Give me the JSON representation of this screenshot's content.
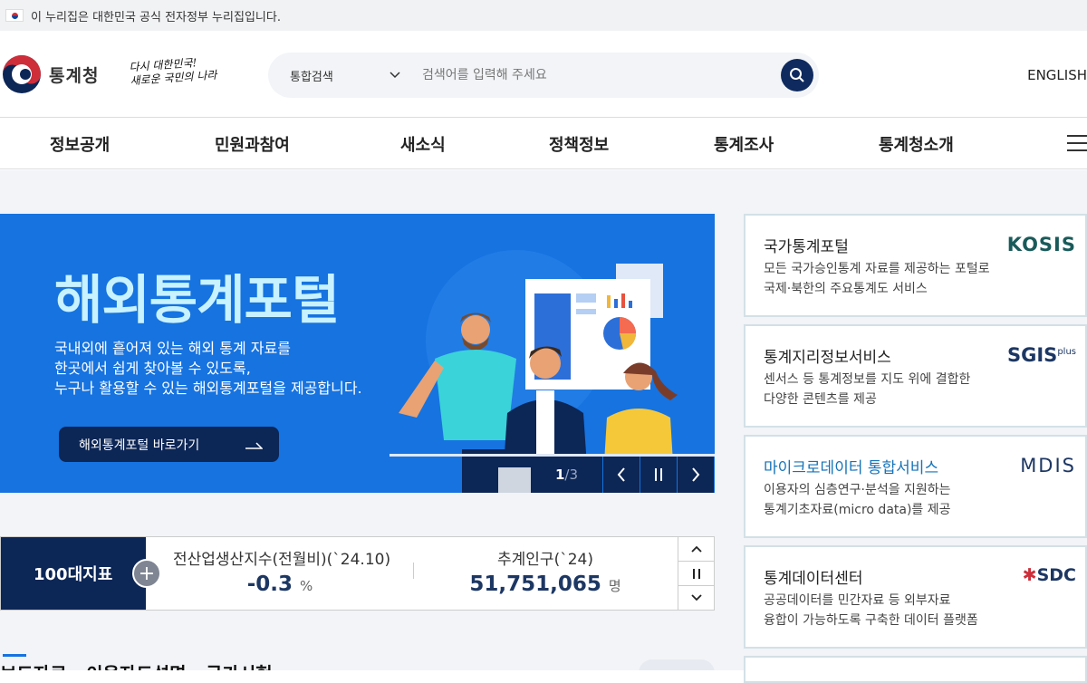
{
  "gov_banner": {
    "text": "이 누리집은 대한민국 공식 전자정부 누리집입니다."
  },
  "header": {
    "logo_name": "통계청",
    "slogan_line1": "다시 대한민국!",
    "slogan_line2": "새로운 국민의 나라",
    "search": {
      "category": "통합검색",
      "placeholder": "검색어를 입력해 주세요"
    },
    "english": "ENGLISH"
  },
  "nav": {
    "items": [
      "정보공개",
      "민원과참여",
      "새소식",
      "정책정보",
      "통계조사",
      "통계청소개"
    ]
  },
  "hero": {
    "title": "해외통계포털",
    "desc": [
      "국내외에 흩어져 있는 해외 통계 자료를",
      "한곳에서 쉽게 찾아볼 수 있도록,",
      "누구나 활용할 수 있는 해외통계포털을 제공합니다."
    ],
    "button_label": "해외통계포털 바로가기",
    "current": "1",
    "total": "/3"
  },
  "indicators": {
    "label": "100대지표",
    "items": [
      {
        "title": "전산업생산지수(전월비)(`24.10)",
        "value": "-0.3",
        "unit": "%"
      },
      {
        "title": "추계인구(`24)",
        "value": "51,751,065",
        "unit": "명"
      }
    ]
  },
  "section_title": "보도자료 · 이용자도설명 · 국가시험",
  "services": [
    {
      "title": "국가통계포털",
      "desc": [
        "모든 국가승인통계 자료를 제공하는 포털로",
        "국제·북한의 주요통계도 서비스"
      ],
      "logo": "KOSIS"
    },
    {
      "title": "통계지리정보서비스",
      "desc": [
        "센서스 등 통계정보를 지도 위에 결합한",
        "다양한 콘텐츠를 제공"
      ],
      "logo": "SGIS",
      "logo_sup": "plus"
    },
    {
      "title": "마이크로데이터 통합서비스",
      "desc": [
        "이용자의 심층연구·분석을 지원하는",
        "통계기초자료(micro data)를 제공"
      ],
      "logo": "MDIS"
    },
    {
      "title": "통계데이터센터",
      "desc": [
        "공공데이터를 민간자료 등 외부자료",
        "융합이 가능하도록 구축한 데이터 플랫폼"
      ],
      "logo": "SDC"
    }
  ],
  "colors": {
    "navy": "#0c2656",
    "hero_blue": "#1673e0",
    "accent_red": "#cd2e3a"
  }
}
